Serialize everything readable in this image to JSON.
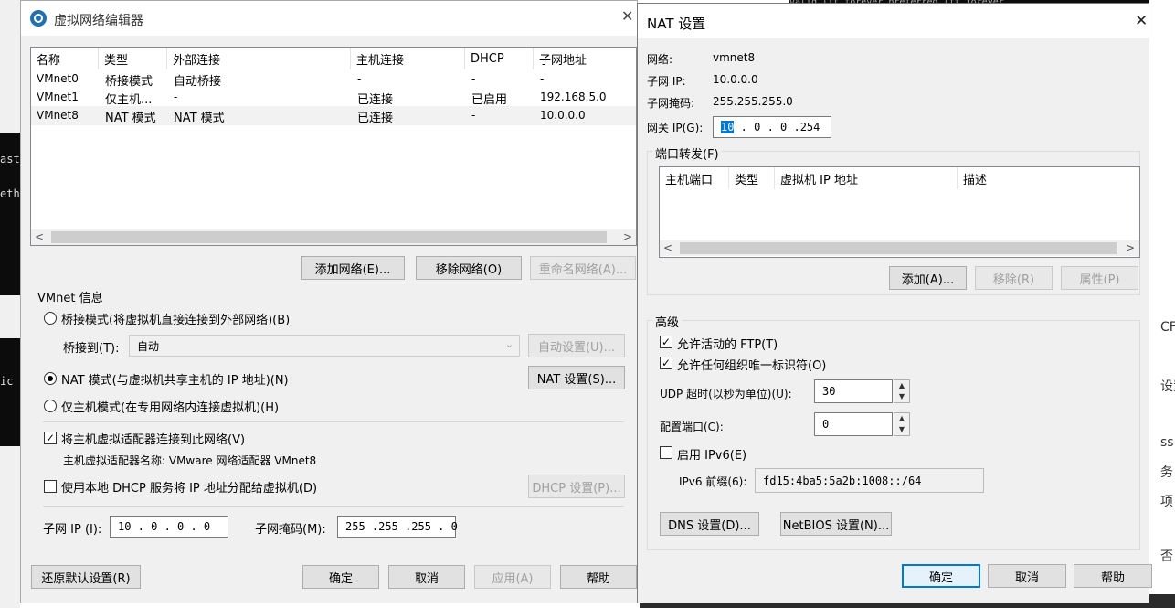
{
  "main_dialog": {
    "title": "虚拟网络编辑器",
    "columns": [
      "名称",
      "类型",
      "外部连接",
      "主机连接",
      "DHCP",
      "子网地址"
    ],
    "rows": [
      [
        "VMnet0",
        "桥接模式",
        "自动桥接",
        "-",
        "-",
        "-"
      ],
      [
        "VMnet1",
        "仅主机...",
        "-",
        "已连接",
        "已启用",
        "192.168.5.0"
      ],
      [
        "VMnet8",
        "NAT 模式",
        "NAT 模式",
        "已连接",
        "-",
        "10.0.0.0"
      ]
    ],
    "add_network": "添加网络(E)...",
    "remove_network": "移除网络(O)",
    "rename_network": "重命名网络(A)...",
    "vmnet_info_label": "VMnet 信息",
    "bridge_mode": "桥接模式(将虚拟机直接连接到外部网络)(B)",
    "bridge_to_label": "桥接到(T):",
    "bridge_to_value": "自动",
    "auto_settings": "自动设置(U)...",
    "nat_mode": "NAT 模式(与虚拟机共享主机的 IP 地址)(N)",
    "nat_settings": "NAT 设置(S)...",
    "host_only_mode": "仅主机模式(在专用网络内连接虚拟机)(H)",
    "connect_adapter": "将主机虚拟适配器连接到此网络(V)",
    "adapter_name": "主机虚拟适配器名称: VMware 网络适配器 VMnet8",
    "use_dhcp": "使用本地 DHCP 服务将 IP 地址分配给虚拟机(D)",
    "dhcp_settings": "DHCP 设置(P)...",
    "subnet_ip_label": "子网 IP (I):",
    "subnet_ip_value": "10 . 0 . 0 . 0",
    "subnet_mask_label": "子网掩码(M):",
    "subnet_mask_value": "255 .255 .255 . 0",
    "restore_defaults": "还原默认设置(R)",
    "ok": "确定",
    "cancel": "取消",
    "apply": "应用(A)",
    "help": "帮助"
  },
  "nat_dialog": {
    "title": "NAT 设置",
    "network_label": "网络:",
    "network_value": "vmnet8",
    "subnet_ip_label": "子网 IP:",
    "subnet_ip_value": "10.0.0.0",
    "subnet_mask_label": "子网掩码:",
    "subnet_mask_value": "255.255.255.0",
    "gateway_label": "网关 IP(G):",
    "gateway_first": "10",
    "gateway_rest": " . 0 . 0 .254",
    "port_forward_label": "端口转发(F)",
    "pf_columns": [
      "主机端口",
      "类型",
      "虚拟机 IP 地址",
      "描述"
    ],
    "add": "添加(A)...",
    "remove": "移除(R)",
    "properties": "属性(P)",
    "advanced_label": "高级",
    "allow_ftp": "允许活动的 FTP(T)",
    "allow_oui": "允许任何组织唯一标识符(O)",
    "udp_timeout_label": "UDP 超时(以秒为单位)(U):",
    "udp_timeout_value": "30",
    "config_port_label": "配置端口(C):",
    "config_port_value": "0",
    "enable_ipv6": "启用 IPv6(E)",
    "ipv6_prefix_label": "IPv6 前缀(6):",
    "ipv6_prefix_value": "fd15:4ba5:5a2b:1008::/64",
    "dns_settings": "DNS 设置(D)...",
    "netbios_settings": "NetBIOS 设置(N)...",
    "ok": "确定",
    "cancel": "取消",
    "help": "帮助"
  },
  "background": {
    "terminal_top": "valid_lft forever preferred_lft forever",
    "term_text_1": "ast",
    "term_text_2": "eth",
    "term_text_3": "ic",
    "right_text_1": "CF",
    "right_text_2": "设置",
    "right_text_3": "ss",
    "right_text_4": "务",
    "right_text_5": "项",
    "right_text_6": "否"
  },
  "colors": {
    "accent": "#0078d7",
    "selection": "#cce4f7"
  }
}
